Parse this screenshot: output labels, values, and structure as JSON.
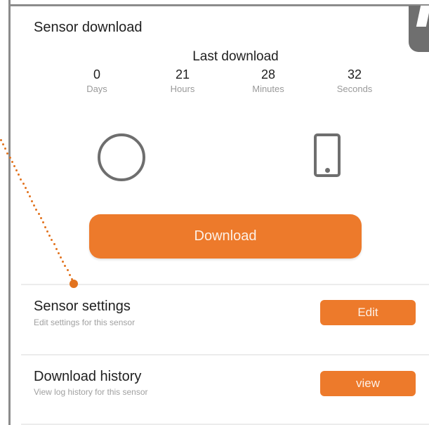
{
  "header": {
    "title": "Sensor download"
  },
  "last_download": {
    "title": "Last download",
    "counters": [
      {
        "value": "0",
        "unit": "Days"
      },
      {
        "value": "21",
        "unit": "Hours"
      },
      {
        "value": "28",
        "unit": "Minutes"
      },
      {
        "value": "32",
        "unit": "Seconds"
      }
    ]
  },
  "icons": {
    "status": "circle-icon",
    "device": "phone-icon"
  },
  "actions": {
    "download_label": "Download"
  },
  "sections": [
    {
      "title": "Sensor settings",
      "subtitle": "Edit settings for this sensor",
      "button": "Edit"
    },
    {
      "title": "Download history",
      "subtitle": "View log history for this sensor",
      "button": "view"
    }
  ],
  "colors": {
    "accent": "#ed7a2b",
    "annotation": "#e2731f",
    "icon": "#6e6e6e"
  }
}
